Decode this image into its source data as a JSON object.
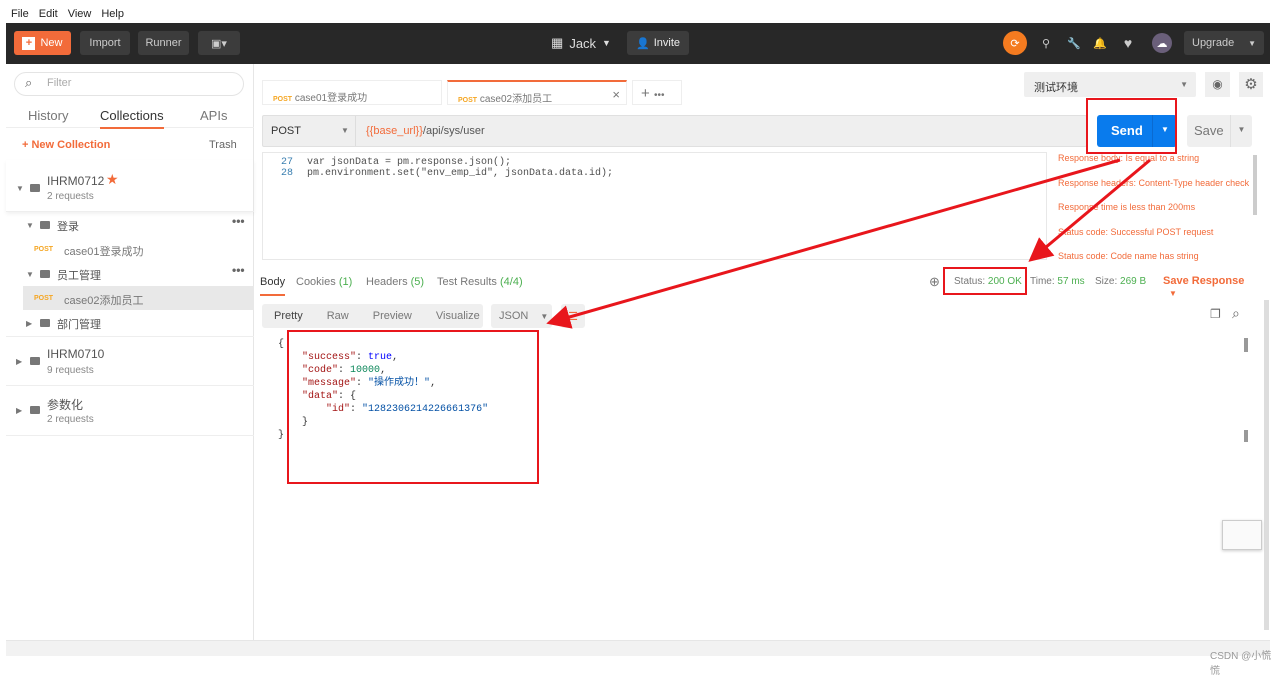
{
  "menu": [
    "File",
    "Edit",
    "View",
    "Help"
  ],
  "header": {
    "new": "New",
    "import": "Import",
    "runner": "Runner",
    "workspace": "Jack",
    "invite": "Invite",
    "upgrade": "Upgrade"
  },
  "sidebar": {
    "filter_placeholder": "Filter",
    "tabs": [
      "History",
      "Collections",
      "APIs"
    ],
    "new_collection": "+ New Collection",
    "trash": "Trash",
    "collections": [
      {
        "name": "IHRM0712",
        "count": "2 requests"
      },
      {
        "name": "IHRM0710",
        "count": "9 requests"
      },
      {
        "name": "参数化",
        "count": "2 requests"
      }
    ],
    "folders": [
      "登录",
      "员工管理",
      "部门管理"
    ],
    "requests": [
      {
        "method": "POST",
        "name": "case01登录成功"
      },
      {
        "method": "POST",
        "name": "case02添加员工"
      }
    ]
  },
  "tabs": [
    {
      "method": "POST",
      "name": "case01登录成功"
    },
    {
      "method": "POST",
      "name": "case02添加员工"
    }
  ],
  "environment": "测试环境",
  "request": {
    "method": "POST",
    "url_var": "{{base_url}}",
    "url_path": "/api/sys/user",
    "send": "Send",
    "save": "Save"
  },
  "editor": {
    "lines": [
      {
        "n": "27",
        "code": "var jsonData = pm.response.json();"
      },
      {
        "n": "28",
        "code": "pm.environment.set(\"env_emp_id\", jsonData.data.id);"
      }
    ]
  },
  "tests": [
    "Response body: Is equal to a string",
    "Response headers: Content-Type header check",
    "Response time is less than 200ms",
    "Status code: Successful POST request",
    "Status code: Code name has string"
  ],
  "response": {
    "tabs": {
      "body": "Body",
      "cookies": "Cookies",
      "cookies_count": "(1)",
      "headers": "Headers",
      "headers_count": "(5)",
      "tests": "Test Results",
      "tests_count": "(4/4)"
    },
    "status_label": "Status:",
    "status": "200 OK",
    "time_label": "Time:",
    "time": "57 ms",
    "size_label": "Size:",
    "size": "269 B",
    "save_response": "Save Response",
    "views": [
      "Pretty",
      "Raw",
      "Preview",
      "Visualize"
    ],
    "format": "JSON",
    "json": {
      "l1": "{",
      "success_k": "\"success\"",
      "success_v": "true",
      "code_k": "\"code\"",
      "code_v": "10000",
      "message_k": "\"message\"",
      "message_v": "\"操作成功！\"",
      "data_k": "\"data\"",
      "id_k": "\"id\"",
      "id_v": "\"1282306214226661376\"",
      "close_inner": "}",
      "close": "}"
    }
  },
  "watermark": "CSDN @小慌慌"
}
